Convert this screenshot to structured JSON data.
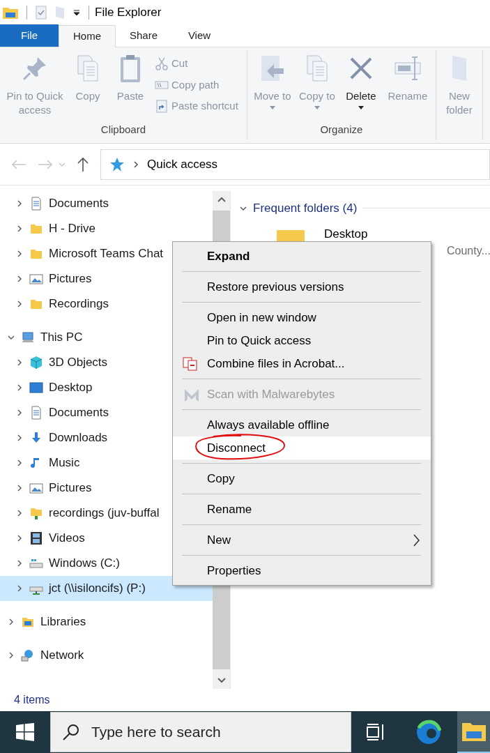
{
  "window": {
    "title": "File Explorer"
  },
  "ribbon_tabs": [
    {
      "label": "File",
      "kind": "file",
      "selected": false
    },
    {
      "label": "Home",
      "kind": "tab",
      "selected": true
    },
    {
      "label": "Share",
      "kind": "tab",
      "selected": false
    },
    {
      "label": "View",
      "kind": "tab",
      "selected": false
    }
  ],
  "ribbon_groups": [
    {
      "label": "Clipboard",
      "large": [
        {
          "label": "Pin to Quick access",
          "disabled": true,
          "dropdown": false
        },
        {
          "label": "Copy",
          "disabled": true,
          "dropdown": false
        },
        {
          "label": "Paste",
          "disabled": true,
          "dropdown": false
        }
      ],
      "small": [
        {
          "label": "Cut",
          "disabled": true
        },
        {
          "label": "Copy path",
          "disabled": true
        },
        {
          "label": "Paste shortcut",
          "disabled": true
        }
      ]
    },
    {
      "label": "Organize",
      "large": [
        {
          "label": "Move to",
          "disabled": true,
          "dropdown": true
        },
        {
          "label": "Copy to",
          "disabled": true,
          "dropdown": true
        },
        {
          "label": "Delete",
          "disabled": false,
          "dropdown": true
        },
        {
          "label": "Rename",
          "disabled": true,
          "dropdown": false
        }
      ]
    },
    {
      "large": [
        {
          "label": "New folder",
          "disabled": true,
          "dropdown": false
        }
      ]
    }
  ],
  "address": {
    "path": "Quick access"
  },
  "nav": {
    "quick_access_items": [
      {
        "label": "Documents",
        "kind": "document",
        "selected": false
      },
      {
        "label": "H - Drive",
        "kind": "folder",
        "selected": false
      },
      {
        "label": "Microsoft Teams Chat",
        "kind": "folder",
        "selected": false
      },
      {
        "label": "Pictures",
        "kind": "pictures",
        "selected": false
      },
      {
        "label": "Recordings",
        "kind": "folder",
        "selected": false
      }
    ],
    "tree": [
      {
        "label": "This PC",
        "kind": "pc",
        "expanded": true,
        "selected": false,
        "children": [
          {
            "label": "3D Objects",
            "kind": "cube",
            "selected": false
          },
          {
            "label": "Desktop",
            "kind": "desktop",
            "selected": false
          },
          {
            "label": "Documents",
            "kind": "document",
            "selected": false
          },
          {
            "label": "Downloads",
            "kind": "download",
            "selected": false
          },
          {
            "label": "Music",
            "kind": "music",
            "selected": false
          },
          {
            "label": "Pictures",
            "kind": "pictures",
            "selected": false
          },
          {
            "label": "recordings (juv-buffal",
            "kind": "netfolder",
            "selected": false
          },
          {
            "label": "Videos",
            "kind": "video",
            "selected": false
          },
          {
            "label": "Windows (C:)",
            "kind": "drive",
            "selected": false
          },
          {
            "label": "jct (\\\\isiloncifs) (P:)",
            "kind": "netdrive",
            "selected": true
          }
        ]
      },
      {
        "label": "Libraries",
        "kind": "libraries",
        "expanded": false,
        "selected": false
      },
      {
        "label": "Network",
        "kind": "network",
        "expanded": false,
        "selected": false
      }
    ]
  },
  "content": {
    "section": "Frequent folders (4)",
    "items": [
      {
        "name": "Desktop",
        "detail": "County..."
      }
    ]
  },
  "context_menu": [
    {
      "kind": "item",
      "label": "Expand",
      "bold": true,
      "disabled": false,
      "selected": false
    },
    {
      "kind": "separator"
    },
    {
      "kind": "item",
      "label": "Restore previous versions",
      "bold": false,
      "disabled": false,
      "selected": false
    },
    {
      "kind": "separator"
    },
    {
      "kind": "item",
      "label": "Open in new window",
      "bold": false,
      "disabled": false,
      "selected": false
    },
    {
      "kind": "item",
      "label": "Pin to Quick access",
      "bold": false,
      "disabled": false,
      "selected": false
    },
    {
      "kind": "acrobat",
      "label": "Combine files in Acrobat...",
      "bold": false,
      "disabled": false,
      "selected": false
    },
    {
      "kind": "separator"
    },
    {
      "kind": "malware",
      "label": "Scan with Malwarebytes",
      "bold": false,
      "disabled": true,
      "selected": false
    },
    {
      "kind": "separator"
    },
    {
      "kind": "item",
      "label": "Always available offline",
      "bold": false,
      "disabled": false,
      "selected": false
    },
    {
      "kind": "item",
      "label": "Disconnect",
      "bold": false,
      "disabled": false,
      "selected": true,
      "circled": true
    },
    {
      "kind": "separator"
    },
    {
      "kind": "item",
      "label": "Copy",
      "bold": false,
      "disabled": false,
      "selected": false
    },
    {
      "kind": "separator"
    },
    {
      "kind": "item",
      "label": "Rename",
      "bold": false,
      "disabled": false,
      "selected": false
    },
    {
      "kind": "separator"
    },
    {
      "kind": "submenu",
      "label": "New",
      "bold": false,
      "disabled": false,
      "selected": false
    },
    {
      "kind": "separator"
    },
    {
      "kind": "item",
      "label": "Properties",
      "bold": false,
      "disabled": false,
      "selected": false
    }
  ],
  "status_bar": {
    "items": "4 items"
  },
  "taskbar": {
    "search_placeholder": "Type here to search"
  }
}
